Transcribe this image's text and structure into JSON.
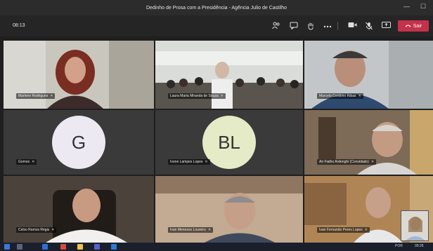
{
  "window": {
    "title": "Dedinho de Prosa com a Presidência - Agência Julio de Castilho",
    "controls": {
      "minimize": "—",
      "maximize": "☐"
    }
  },
  "toolbar": {
    "timer": "08:13",
    "leave_label": "Sair",
    "icons": [
      "people-icon",
      "chat-icon",
      "raise-hand-icon",
      "more-icon",
      "camera-icon",
      "mic-off-icon",
      "share-screen-icon",
      "phone-icon"
    ]
  },
  "participants": [
    {
      "name": "Marlene Rodrigues",
      "muted": true,
      "video": true
    },
    {
      "name": "Laura Maria Miranda de Souza",
      "muted": true,
      "video": true
    },
    {
      "name": "Marcelo Cordeiro Ribas",
      "muted": true,
      "video": true
    },
    {
      "name": "Gomes",
      "muted": true,
      "video": false,
      "initials": "G",
      "avatar_color": "#ece9f2"
    },
    {
      "name": "Ivone Lampes Lopes",
      "muted": true,
      "video": false,
      "initials": "BL",
      "avatar_color": "#e5ebc6"
    },
    {
      "name": "Ari Fialho Ardenghi (Convidado)",
      "muted": true,
      "video": true
    },
    {
      "name": "Celso Ramos Régis",
      "muted": true,
      "video": true
    },
    {
      "name": "Ivan Menezes Loureiro",
      "muted": true,
      "video": true
    },
    {
      "name": "Ivan Fernando Peres Lopes",
      "muted": true,
      "video": true
    }
  ],
  "taskbar": {
    "language": "POR",
    "time": "09:26"
  },
  "colors": {
    "background": "#1f1f1f",
    "titlebar": "#2d2c2c",
    "leave_button": "#c4314b",
    "tile_empty": "#3a3a3a"
  }
}
